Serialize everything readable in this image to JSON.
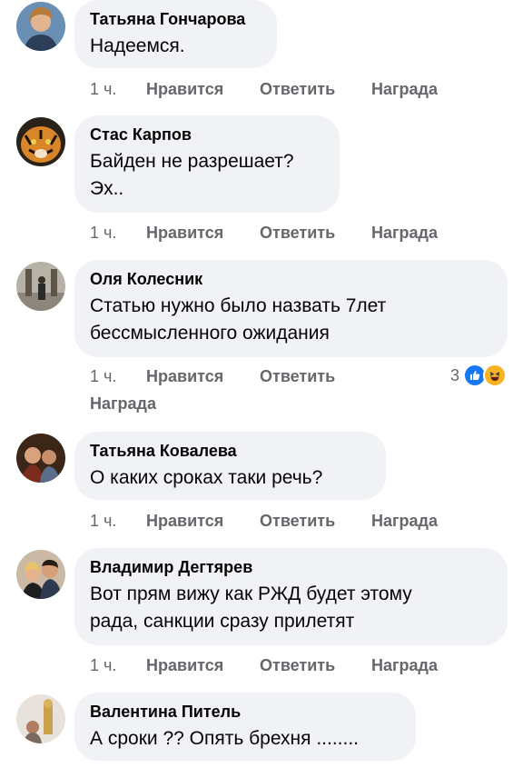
{
  "actions_labels": {
    "like": "Нравится",
    "reply": "Ответить",
    "award": "Награда"
  },
  "comments": [
    {
      "author": "Татьяна Гончарова",
      "lines": [
        "Надеемся."
      ],
      "time": "1 ч."
    },
    {
      "author": "Стас Карпов",
      "lines": [
        "Байден не разрешает?",
        "Эх.."
      ],
      "time": "1 ч."
    },
    {
      "author": "Оля Колесник",
      "lines": [
        "Статью нужно было назвать 7лет",
        "бессмысленного ожидания"
      ],
      "time": "1 ч.",
      "reactions": {
        "count": "3",
        "icons": [
          "like-reaction-icon",
          "haha-reaction-icon"
        ]
      }
    },
    {
      "author": "Татьяна Ковалева",
      "lines": [
        "О каких сроках таки речь?"
      ],
      "time": "1 ч."
    },
    {
      "author": "Владимир Дегтярев",
      "lines": [
        "Вот прям вижу как РЖД будет этому",
        "рада, санкции сразу прилетят"
      ],
      "time": "1 ч."
    },
    {
      "author": "Валентина Питель",
      "lines": [
        "А сроки ?? Опять брехня ........"
      ]
    }
  ],
  "colors": {
    "bubble": "#f0f2f5",
    "secondary_text": "#65676b",
    "like_blue": "#1877f2",
    "haha_yellow": "#f7b125"
  }
}
